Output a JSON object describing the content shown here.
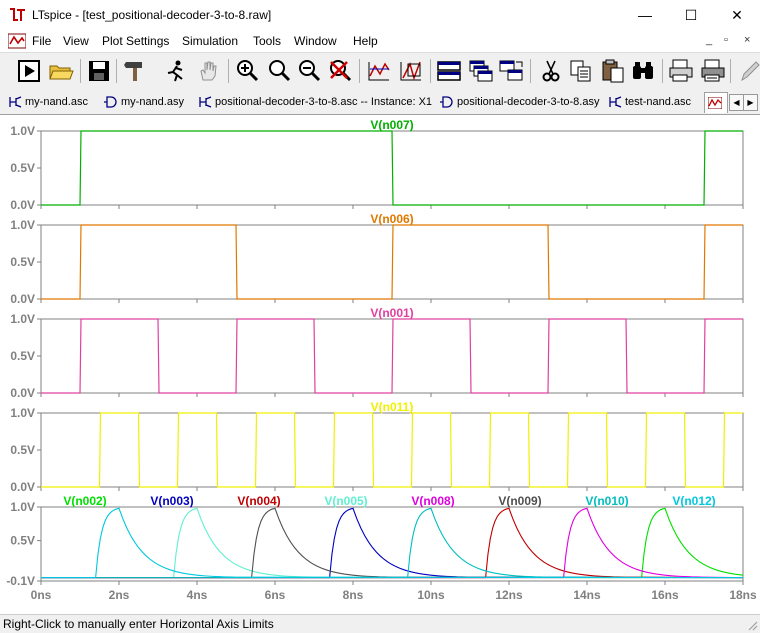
{
  "window": {
    "title": "LTspice - [test_positional-decoder-3-to-8.raw]",
    "minimize": "—",
    "maximize": "☐",
    "close": "✕"
  },
  "menu": {
    "items": [
      "File",
      "View",
      "Plot Settings",
      "Simulation",
      "Tools",
      "Window",
      "Help"
    ],
    "mdi": [
      "_",
      "▫",
      "×"
    ]
  },
  "toolbar": {
    "buttons": [
      "run",
      "open",
      "save",
      "control-panel",
      "run-cursor",
      "pan",
      "zoom-in",
      "zoom-full",
      "zoom-out",
      "cancel-zoom",
      "autorange",
      "fft",
      "tile-horizontal",
      "cascade",
      "tile-vertical",
      "cut",
      "copy",
      "paste",
      "find",
      "print-preview",
      "print",
      "pencil"
    ]
  },
  "tabs": [
    {
      "label": "my-nand.asc",
      "icon": "schematic-icon"
    },
    {
      "label": "my-nand.asy",
      "icon": "symbol-icon"
    },
    {
      "label": "positional-decoder-3-to-8.asc -- Instance: X1",
      "icon": "schematic-icon"
    },
    {
      "label": "positional-decoder-3-to-8.asy",
      "icon": "symbol-icon"
    },
    {
      "label": "test-nand.asc",
      "icon": "schematic-icon"
    },
    {
      "label": "",
      "icon": "waveform-icon"
    }
  ],
  "status": {
    "text": "Right-Click to manually enter Horizontal Axis Limits"
  },
  "chart_data": {
    "type": "line",
    "x_unit": "ns",
    "xlim": [
      0,
      18
    ],
    "x_ticks": [
      "0ns",
      "2ns",
      "4ns",
      "6ns",
      "8ns",
      "10ns",
      "12ns",
      "14ns",
      "16ns",
      "18ns"
    ],
    "panes": [
      {
        "y_ticks": [
          "1.0V",
          "0.5V",
          "0.0V"
        ],
        "ylim": [
          0,
          1
        ],
        "series": [
          {
            "name": "V(n007)",
            "color": "#00b000",
            "kind": "square",
            "period": 16,
            "high": [
              [
                1,
                9
              ],
              [
                17,
                18
              ]
            ]
          }
        ]
      },
      {
        "y_ticks": [
          "1.0V",
          "0.5V",
          "0.0V"
        ],
        "ylim": [
          0,
          1
        ],
        "series": [
          {
            "name": "V(n006)",
            "color": "#e07800",
            "kind": "square",
            "high": [
              [
                1,
                5
              ],
              [
                9,
                13
              ],
              [
                17,
                18
              ]
            ]
          }
        ]
      },
      {
        "y_ticks": [
          "1.0V",
          "0.5V",
          "0.0V"
        ],
        "ylim": [
          0,
          1
        ],
        "series": [
          {
            "name": "V(n001)",
            "color": "#e040a0",
            "kind": "square",
            "high": [
              [
                1,
                3
              ],
              [
                5,
                7
              ],
              [
                9,
                11
              ],
              [
                13,
                15
              ],
              [
                17,
                18
              ]
            ]
          }
        ]
      },
      {
        "y_ticks": [
          "1.0V",
          "0.5V",
          "0.0V"
        ],
        "ylim": [
          0,
          1
        ],
        "series": [
          {
            "name": "V(n011)",
            "color": "#f0f000",
            "kind": "square",
            "high": [
              [
                1.5,
                2.5
              ],
              [
                3.5,
                4.5
              ],
              [
                5.5,
                6.5
              ],
              [
                7.5,
                8.5
              ],
              [
                9.5,
                10.5
              ],
              [
                11.5,
                12.5
              ],
              [
                13.5,
                14.5
              ],
              [
                15.5,
                16.5
              ],
              [
                17.5,
                18
              ]
            ]
          }
        ]
      },
      {
        "y_ticks": [
          "1.0V",
          "0.5V",
          "-0.1V"
        ],
        "ylim": [
          -0.1,
          1
        ],
        "series": [
          {
            "name": "V(n002)",
            "color": "#00e000",
            "kind": "pulse",
            "rise": 15.5
          },
          {
            "name": "V(n003)",
            "color": "#0000c0",
            "kind": "pulse",
            "rise": 7.5
          },
          {
            "name": "V(n004)",
            "color": "#c00000",
            "kind": "pulse",
            "rise": 11.5
          },
          {
            "name": "V(n005)",
            "color": "#60f0d0",
            "kind": "pulse",
            "rise": 3.5
          },
          {
            "name": "V(n008)",
            "color": "#e000e0",
            "kind": "pulse",
            "rise": 13.5
          },
          {
            "name": "V(n009)",
            "color": "#505050",
            "kind": "pulse",
            "rise": 5.5
          },
          {
            "name": "V(n010)",
            "color": "#00c0c0",
            "kind": "pulse",
            "rise": 9.5
          },
          {
            "name": "V(n012)",
            "color": "#00c8e0",
            "kind": "pulse",
            "rise": 1.5
          }
        ]
      }
    ]
  }
}
